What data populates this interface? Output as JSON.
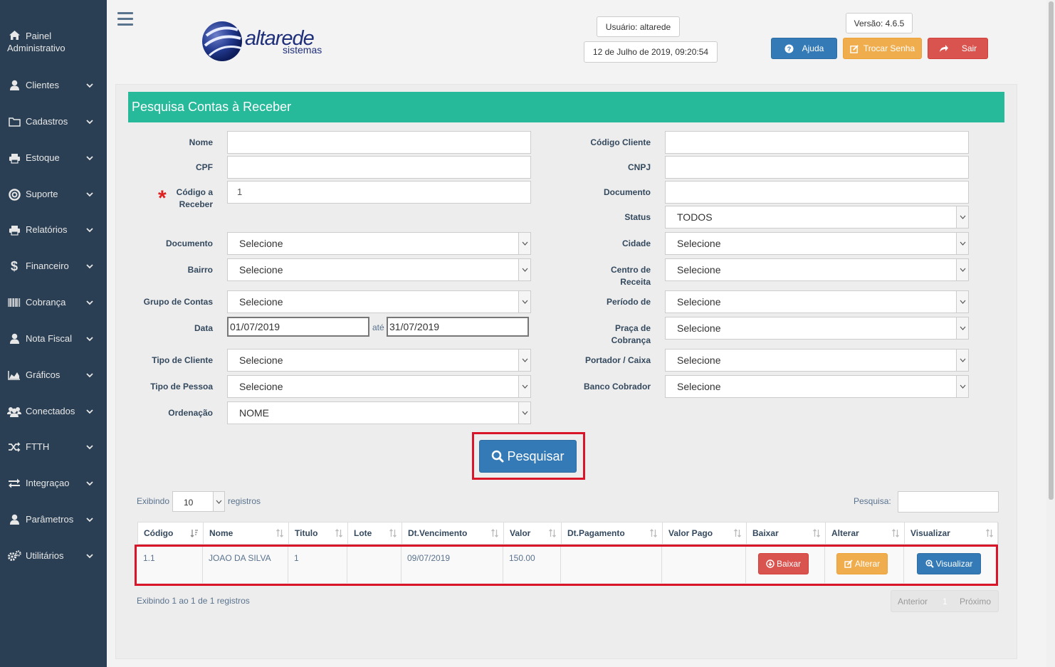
{
  "sidebar": {
    "items": [
      {
        "label": "Painel Administrativo",
        "icon": "home-icon"
      },
      {
        "label": "Clientes",
        "icon": "user-icon"
      },
      {
        "label": "Cadastros",
        "icon": "folder-icon"
      },
      {
        "label": "Estoque",
        "icon": "print-icon"
      },
      {
        "label": "Suporte",
        "icon": "life-ring-icon"
      },
      {
        "label": "Relatórios",
        "icon": "print-icon"
      },
      {
        "label": "Financeiro",
        "icon": "dollar-icon"
      },
      {
        "label": "Cobrança",
        "icon": "barcode-icon"
      },
      {
        "label": "Nota Fiscal",
        "icon": "user-icon"
      },
      {
        "label": "Gráficos",
        "icon": "area-chart-icon"
      },
      {
        "label": "Conectados",
        "icon": "users-icon"
      },
      {
        "label": "FTTH",
        "icon": "random-icon"
      },
      {
        "label": "Integraçao",
        "icon": "exchange-icon"
      },
      {
        "label": "Parâmetros",
        "icon": "user-icon"
      },
      {
        "label": "Utilitários",
        "icon": "cogs-icon"
      }
    ]
  },
  "header": {
    "logo_main": "altarede",
    "logo_sub": "sistemas",
    "user": "Usuário: altarede",
    "datetime": "12 de Julho de 2019, 09:20:54",
    "version": "Versão: 4.6.5",
    "help_label": "Ajuda",
    "change_password_label": "Trocar Senha",
    "logout_label": "Sair"
  },
  "panel": {
    "title": "Pesquisa Contas à Receber"
  },
  "form": {
    "nome_label": "Nome",
    "cpf_label": "CPF",
    "codigo_receber_label": "Código a Receber",
    "codigo_receber_value": "1",
    "required_mark": "*",
    "codigo_cliente_label": "Código Cliente",
    "cnpj_label": "CNPJ",
    "documento_right_label": "Documento",
    "status_label": "Status",
    "status_value": "TODOS",
    "documento_label": "Documento",
    "documento_value": "Selecione",
    "cidade_label": "Cidade",
    "cidade_value": "Selecione",
    "bairro_label": "Bairro",
    "bairro_value": "Selecione",
    "centro_receita_label": "Centro de Receita",
    "centro_receita_value": "Selecione",
    "grupo_contas_label": "Grupo de Contas",
    "grupo_contas_value": "Selecione",
    "periodo_label": "Período de",
    "periodo_value": "Selecione",
    "data_label": "Data",
    "data_from": "01/07/2019",
    "data_sep": "até",
    "data_to": "31/07/2019",
    "praca_label": "Praça de Cobrança",
    "praca_value": "Selecione",
    "tipo_cliente_label": "Tipo de Cliente",
    "tipo_cliente_value": "Selecione",
    "portador_label": "Portador / Caixa",
    "portador_value": "Selecione",
    "tipo_pessoa_label": "Tipo de Pessoa",
    "tipo_pessoa_value": "Selecione",
    "banco_label": "Banco Cobrador",
    "banco_value": "Selecione",
    "ordenacao_label": "Ordenação",
    "ordenacao_value": "NOME",
    "search_button": "Pesquisar"
  },
  "table": {
    "show_label": "Exibindo",
    "show_value": "10",
    "records_label": "registros",
    "search_label": "Pesquisa:",
    "columns": [
      "Código",
      "Nome",
      "Titulo",
      "Lote",
      "Dt.Vencimento",
      "Valor",
      "Dt.Pagamento",
      "Valor Pago",
      "Baixar",
      "Alterar",
      "Visualizar"
    ],
    "rows": [
      {
        "codigo": "1.1",
        "nome": "JOAO DA SILVA",
        "titulo": "1",
        "lote": "",
        "vencimento": "09/07/2019",
        "valor": "150.00",
        "pagamento": "",
        "valor_pago": "",
        "baixar": "Baixar",
        "alterar": "Alterar",
        "visualizar": "Visualizar"
      }
    ],
    "info": "Exibindo 1 ao 1 de 1 registros",
    "pager_prev": "Anterior",
    "pager_page": "1",
    "pager_next": "Próximo"
  },
  "colors": {
    "sidebar": "#2a3f54",
    "panel_title": "#26b99a",
    "primary": "#337ab7",
    "warning": "#f0ad4e",
    "danger": "#d9534f",
    "highlight": "#d9152a"
  }
}
